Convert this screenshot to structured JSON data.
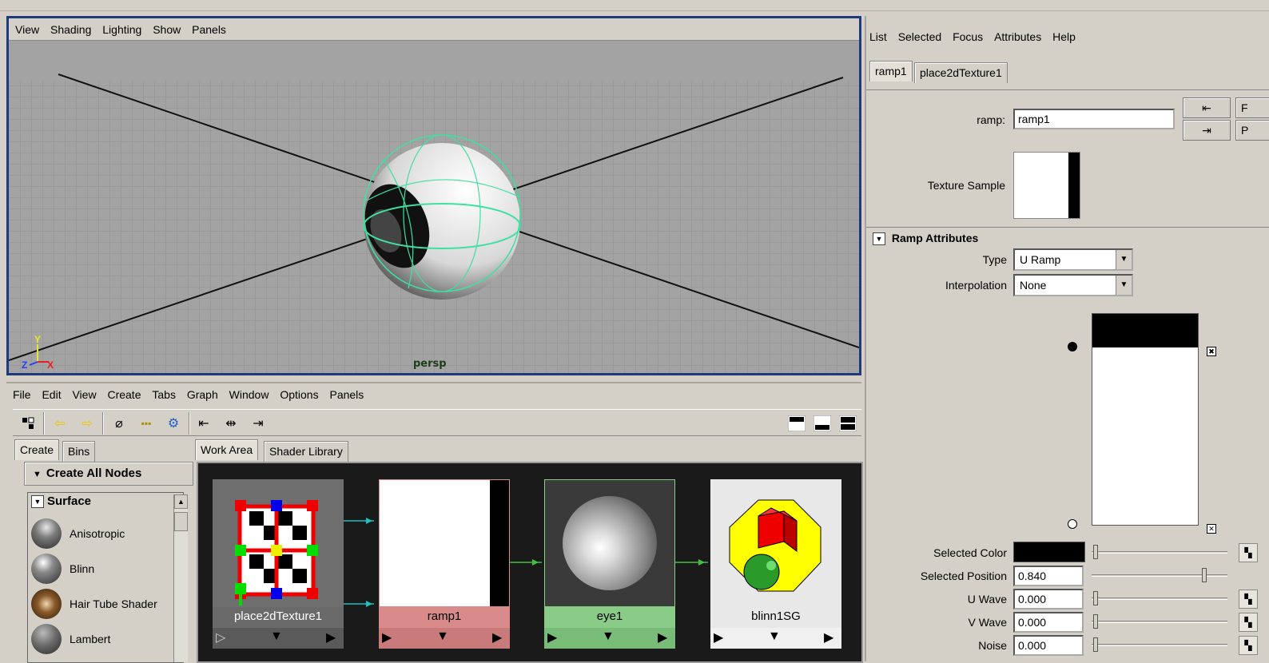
{
  "viewport": {
    "menu": [
      "View",
      "Shading",
      "Lighting",
      "Show",
      "Panels"
    ],
    "camera_label": "persp",
    "axis_labels": {
      "x": "X",
      "y": "Y",
      "z": "Z"
    }
  },
  "hypershade": {
    "menu": [
      "File",
      "Edit",
      "View",
      "Create",
      "Tabs",
      "Graph",
      "Window",
      "Options",
      "Panels"
    ],
    "toolbar_icons": [
      "graph-icon",
      "back-arrow-icon",
      "forward-arrow-icon",
      "eraser-icon",
      "grid-layout-icon",
      "network-icon",
      "input-connections-icon",
      "in-out-connections-icon",
      "output-connections-icon"
    ],
    "layout_icons": [
      "layout-top-icon",
      "layout-bottom-icon",
      "layout-split-icon"
    ],
    "left_tabs": [
      "Create",
      "Bins"
    ],
    "create_header": "Create All Nodes",
    "surface_header": "Surface",
    "shaders": [
      {
        "name": "Anisotropic",
        "color": "#555555"
      },
      {
        "name": "Blinn",
        "color": "#5a5a5a"
      },
      {
        "name": "Hair Tube Shader",
        "color": "#6a4a2a"
      },
      {
        "name": "Lambert",
        "color": "#5a5a5a"
      }
    ],
    "work_tabs": [
      "Work Area",
      "Shader Library"
    ],
    "nodes": [
      {
        "name": "place2dTexture1",
        "label_color": "#6a6a6a"
      },
      {
        "name": "ramp1",
        "label_color": "#d98a8a"
      },
      {
        "name": "eye1",
        "label_color": "#88cc88"
      },
      {
        "name": "blinn1SG",
        "label_color": "#e8e8e8"
      }
    ]
  },
  "attribute_editor": {
    "menu": [
      "List",
      "Selected",
      "Focus",
      "Attributes",
      "Help"
    ],
    "tabs": [
      "ramp1",
      "place2dTexture1"
    ],
    "ramp_label": "ramp:",
    "ramp_value": "ramp1",
    "right_buttons": [
      "F",
      "P"
    ],
    "texture_sample_label": "Texture Sample",
    "section_title": "Ramp Attributes",
    "type_label": "Type",
    "type_value": "U Ramp",
    "interp_label": "Interpolation",
    "interp_value": "None",
    "rows": [
      {
        "label": "Selected Color",
        "value": ""
      },
      {
        "label": "Selected Position",
        "value": "0.840"
      },
      {
        "label": "U Wave",
        "value": "0.000"
      },
      {
        "label": "V Wave",
        "value": "0.000"
      },
      {
        "label": "Noise",
        "value": "0.000"
      }
    ],
    "selected_position_fraction": 0.84
  }
}
